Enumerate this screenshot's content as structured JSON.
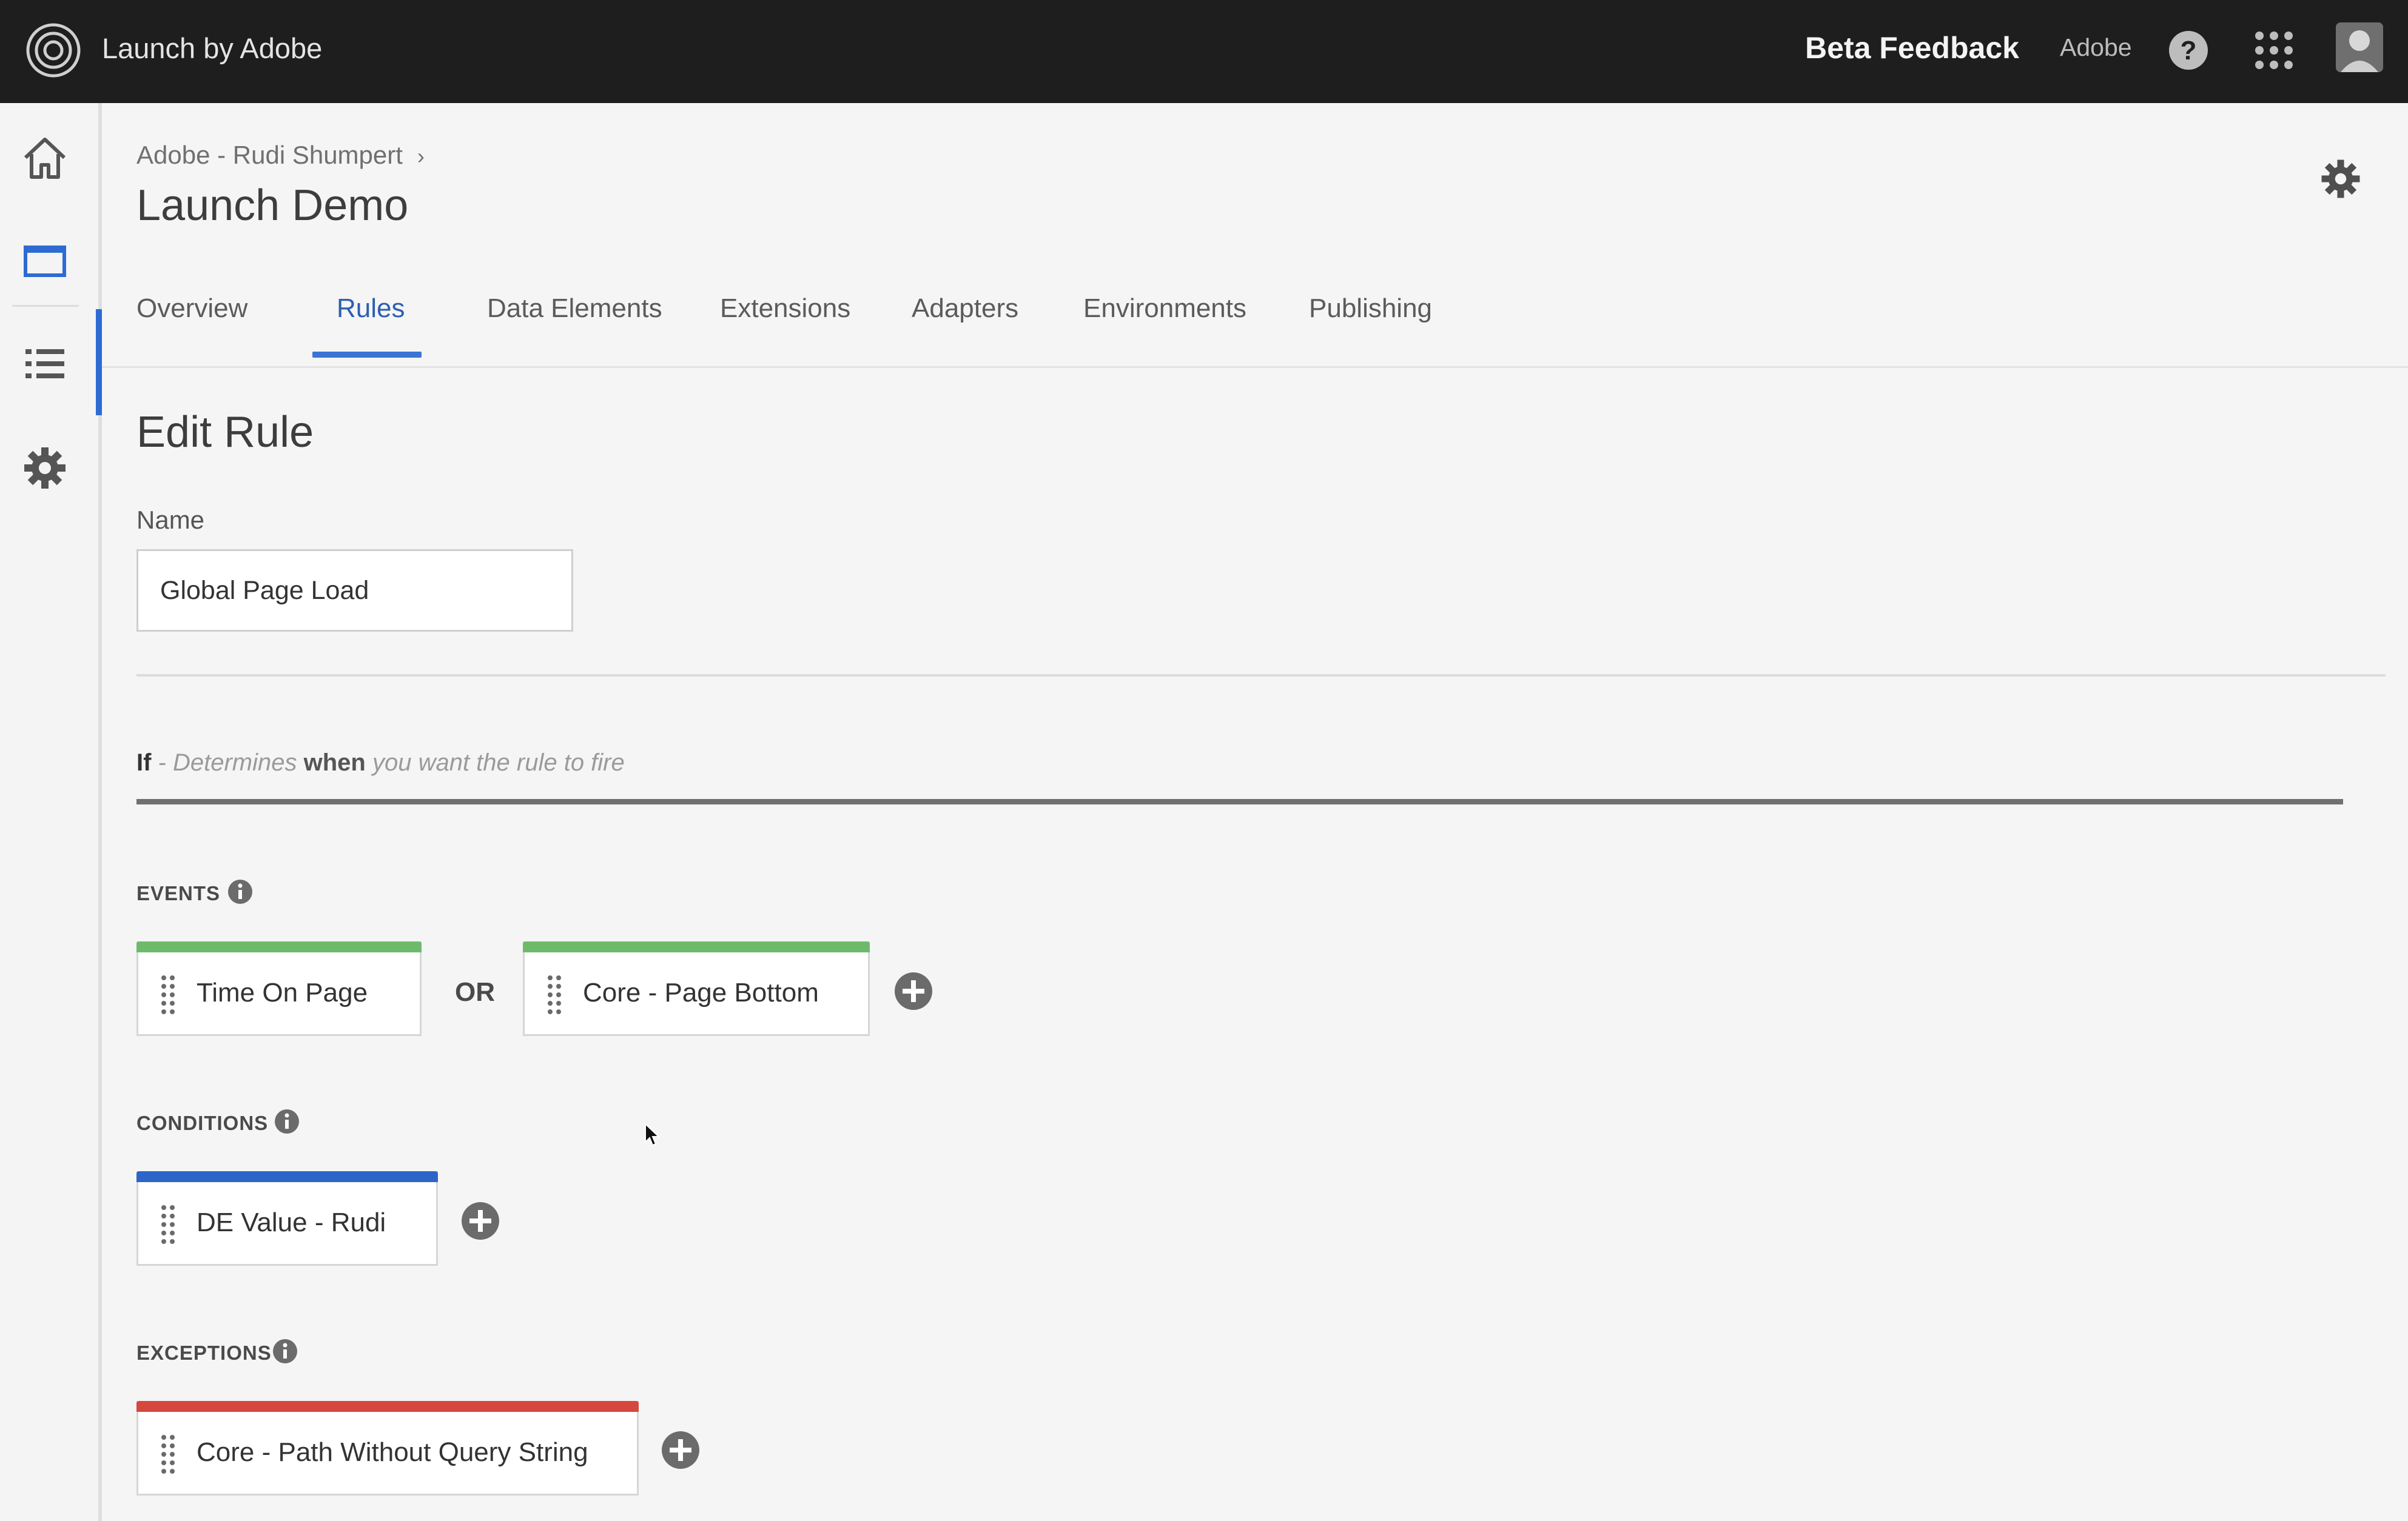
{
  "app": {
    "title": "Launch by Adobe",
    "beta_feedback": "Beta Feedback",
    "org": "Adobe"
  },
  "header": {
    "breadcrumb": "Adobe - Rudi Shumpert",
    "breadcrumb_separator": "›",
    "title": "Launch Demo"
  },
  "tabs": [
    {
      "label": "Overview"
    },
    {
      "label": "Rules",
      "active": true
    },
    {
      "label": "Data Elements"
    },
    {
      "label": "Extensions"
    },
    {
      "label": "Adapters"
    },
    {
      "label": "Environments"
    },
    {
      "label": "Publishing"
    }
  ],
  "rule": {
    "heading": "Edit Rule",
    "name_label": "Name",
    "name_value": "Global Page Load",
    "if_word": "If",
    "if_prefix": " - Determines ",
    "if_when": "when",
    "if_suffix": " you want the rule to fire",
    "or_label": "OR"
  },
  "sections": {
    "events": {
      "label": "EVENTS",
      "cards": [
        {
          "label": "Time On Page"
        },
        {
          "label": "Core - Page Bottom"
        }
      ]
    },
    "conditions": {
      "label": "CONDITIONS",
      "cards": [
        {
          "label": "DE Value - Rudi"
        }
      ]
    },
    "exceptions": {
      "label": "EXCEPTIONS",
      "cards": [
        {
          "label": "Core - Path Without Query String"
        }
      ]
    }
  },
  "colors": {
    "accent_blue": "#2d6bd3",
    "event_green": "#6dbb6a",
    "condition_blue": "#2b65c8",
    "exception_red": "#d6473d",
    "topbar": "#1e1e1e"
  },
  "icons": [
    "adobe-launch-logo-icon",
    "help-icon",
    "apps-grid-icon",
    "home-icon",
    "window-icon",
    "list-icon",
    "gear-icon",
    "info-icon",
    "drag-handle-icon",
    "add-circle-icon"
  ]
}
